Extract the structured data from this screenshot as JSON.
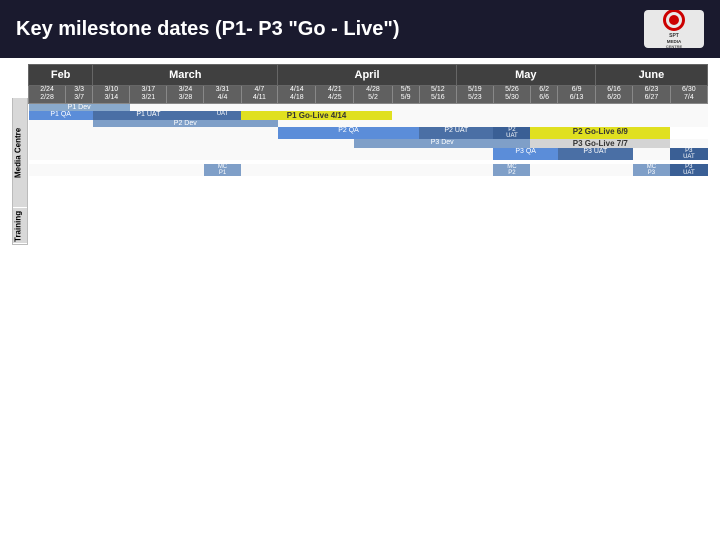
{
  "header": {
    "title": "Key milestone dates (P1- P3 \"Go - Live\")"
  },
  "months": [
    {
      "label": "Feb",
      "colspan": 2
    },
    {
      "label": "March",
      "colspan": 5
    },
    {
      "label": "April",
      "colspan": 5
    },
    {
      "label": "May",
      "colspan": 4
    },
    {
      "label": "June",
      "colspan": 5
    }
  ],
  "weeks": [
    "2/24\n2/28",
    "3/3\n3/7",
    "3/10\n3/14",
    "3/17\n3/21",
    "3/24\n3/28",
    "3/31\n4/4",
    "4/7\n4/11",
    "4/14\n4/18",
    "4/21\n4/25",
    "4/28\n5/2",
    "5/5\n5/9",
    "5/12\n5/16",
    "5/19\n5/23",
    "5/26\n5/30",
    "6/2\n6/6",
    "6/9\n6/13",
    "6/16\n6/20",
    "6/23\n6/27",
    "6/30\n7/4"
  ],
  "rows": {
    "media_centre": [
      {
        "type": "section_label",
        "text": "Media Centre"
      },
      {
        "name": "P1 Dev",
        "bars": [
          {
            "start": 0,
            "span": 3,
            "type": "dev",
            "label": "P1 Dev"
          }
        ]
      },
      {
        "name": "P1 QA + P1 UAT",
        "bars": [
          {
            "start": 0,
            "span": 2,
            "type": "qa",
            "label": "P1 QA"
          },
          {
            "start": 2,
            "span": 3,
            "type": "uat",
            "label": "P1 UAT"
          },
          {
            "start": 5,
            "span": 1,
            "type": "uat",
            "label": "UAT"
          },
          {
            "start": 6,
            "span": 4,
            "type": "golive",
            "label": "P1 Go-Live 4/14"
          }
        ]
      },
      {
        "name": "P2 Dev",
        "bars": [
          {
            "start": 2,
            "span": 5,
            "type": "dev",
            "label": "P2 Dev"
          }
        ]
      },
      {
        "name": "P2 QA + UAT",
        "bars": [
          {
            "start": 7,
            "span": 4,
            "type": "qa",
            "label": "P2 QA"
          },
          {
            "start": 11,
            "span": 2,
            "type": "uat",
            "label": "P2 UAT"
          },
          {
            "start": 13,
            "span": 1,
            "type": "uat_sm",
            "label": "P2\nUAT"
          },
          {
            "start": 14,
            "span": 4,
            "type": "golive",
            "label": "P2 Go-Live 6/9"
          }
        ]
      },
      {
        "name": "P3 Dev",
        "bars": [
          {
            "start": 9,
            "span": 5,
            "type": "dev",
            "label": "P3 Dev"
          },
          {
            "start": 14,
            "span": 4,
            "type": "golive",
            "label": "P3 Go-Live 7/7"
          }
        ]
      },
      {
        "name": "P3 QA + UAT",
        "bars": [
          {
            "start": 13,
            "span": 2,
            "type": "qa",
            "label": "P3 QA"
          },
          {
            "start": 15,
            "span": 2,
            "type": "uat",
            "label": "P3 UAT"
          },
          {
            "start": 18,
            "span": 1,
            "type": "uat_sm",
            "label": "P3\nUAT"
          }
        ]
      }
    ],
    "training": [
      {
        "name": "Training MC P1",
        "bars": [
          {
            "start": 5,
            "span": 1,
            "type": "mc",
            "label": "MC\nP1"
          }
        ]
      },
      {
        "name": "Training MC P2",
        "bars": [
          {
            "start": 13,
            "span": 1,
            "type": "mc",
            "label": "MC\nP2"
          }
        ]
      },
      {
        "name": "Training MC P3",
        "bars": [
          {
            "start": 17,
            "span": 1,
            "type": "mc",
            "label": "MC\nP3"
          },
          {
            "start": 18,
            "span": 1,
            "type": "uat_sm",
            "label": "P3\nUAT"
          }
        ]
      }
    ]
  },
  "colors": {
    "header_bg": "#1c1c2e",
    "month_bg": "#404040",
    "week_bg": "#606060",
    "bar_dev": "#7f9fc8",
    "bar_qa": "#5b8dd9",
    "bar_uat": "#4a6fa5",
    "bar_golive": "#e8e000",
    "bar_mc": "#7f9fc8",
    "side_label": "#c8c8c8"
  }
}
